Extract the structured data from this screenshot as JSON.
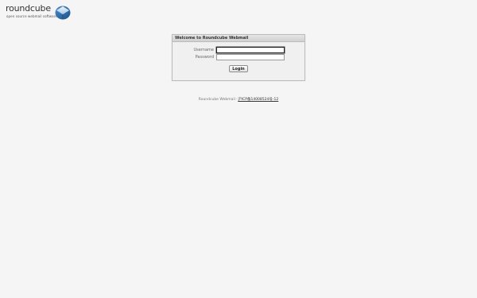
{
  "logo": {
    "brand": "roundcube",
    "tagline": "open source webmail software",
    "icon": "roundcube-logo-icon"
  },
  "login": {
    "title": "Welcome to Roundcube Webmail",
    "username_label": "Username",
    "username_value": "",
    "password_label": "Password",
    "password_value": "",
    "submit_label": "Login"
  },
  "footer": {
    "product": "Roundcube Webmail",
    "separator": "·",
    "link": "沪ICP备14008524号-12"
  },
  "colors": {
    "background": "#f5f5f5",
    "box_bg": "#f0f0f0",
    "logo_blue": "#2c6fb3"
  }
}
